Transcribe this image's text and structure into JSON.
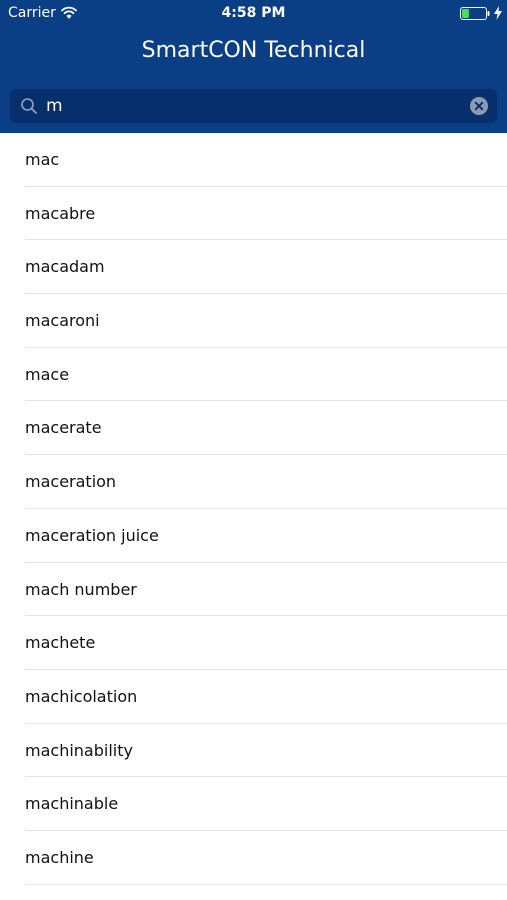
{
  "status_bar": {
    "carrier": "Carrier",
    "time": "4:58 PM",
    "battery_level": 0.3
  },
  "nav": {
    "title": "SmartCON Technical"
  },
  "search": {
    "value": "m",
    "icon": "search-icon",
    "clear_icon": "clear-icon"
  },
  "results": [
    "mac",
    "macabre",
    "macadam",
    "macaroni",
    "mace",
    "macerate",
    "maceration",
    "maceration juice",
    "mach number",
    "machete",
    "machicolation",
    "machinability",
    "machinable",
    "machine"
  ],
  "colors": {
    "header_bg": "#0a3f86",
    "search_bg": "#062f6b",
    "battery_fill": "#4cd964",
    "separator": "#e3e3e6"
  }
}
